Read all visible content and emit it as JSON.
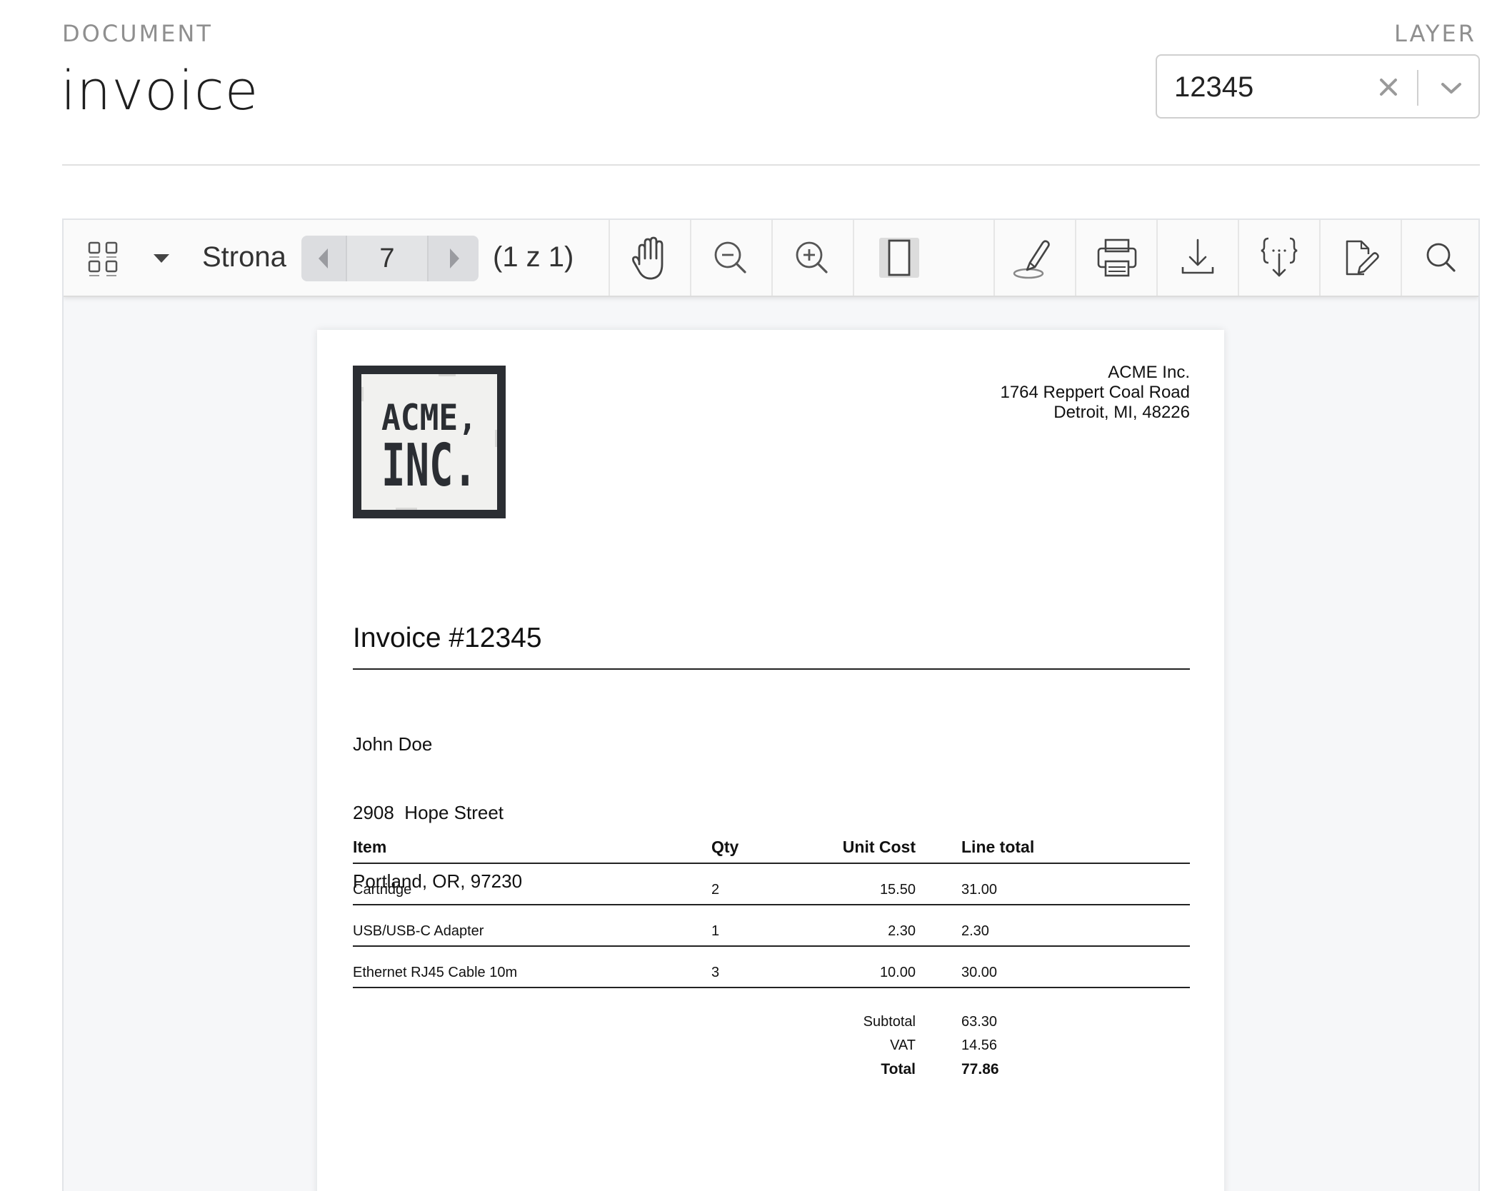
{
  "header": {
    "document_label": "DOCUMENT",
    "document_title": "invoice",
    "layer_label": "LAYER",
    "layer_value": "12345"
  },
  "toolbar": {
    "page_label": "Strona",
    "page_number": "7",
    "page_count": "(1 z 1)",
    "icons": [
      "thumbnails-icon",
      "dropdown-caret-icon",
      "hand-tool-icon",
      "zoom-out-icon",
      "zoom-in-icon",
      "fit-page-icon",
      "annotate-pen-icon",
      "print-icon",
      "download-icon",
      "export-data-icon",
      "edit-document-icon",
      "search-icon"
    ]
  },
  "invoice": {
    "logo_text": [
      "ACME,",
      "INC."
    ],
    "company": {
      "name": "ACME Inc.",
      "street": "1764 Reppert Coal Road",
      "city": "Detroit, MI, 48226"
    },
    "title": "Invoice #12345",
    "customer": {
      "name": "John Doe",
      "street": "2908  Hope Street",
      "city": "Portland, OR, 97230"
    },
    "columns": {
      "item": "Item",
      "qty": "Qty",
      "unit_cost": "Unit Cost",
      "line_total": "Line total"
    },
    "rows": [
      {
        "item": "Cartridge",
        "qty": "2",
        "unit_cost": "15.50",
        "line_total": "31.00"
      },
      {
        "item": "USB/USB-C Adapter",
        "qty": "1",
        "unit_cost": "2.30",
        "line_total": "2.30"
      },
      {
        "item": "Ethernet RJ45 Cable 10m",
        "qty": "3",
        "unit_cost": "10.00",
        "line_total": "30.00"
      }
    ],
    "totals": {
      "subtotal_label": "Subtotal",
      "subtotal": "63.30",
      "vat_label": "VAT",
      "vat": "14.56",
      "total_label": "Total",
      "total": "77.86"
    }
  },
  "colors": {
    "label_gray": "#8f8f8f",
    "viewer_bg": "#f6f7f9",
    "toolbar_bg": "#fafafa",
    "icon": "#555555",
    "logo_dark": "#2b2e33"
  }
}
